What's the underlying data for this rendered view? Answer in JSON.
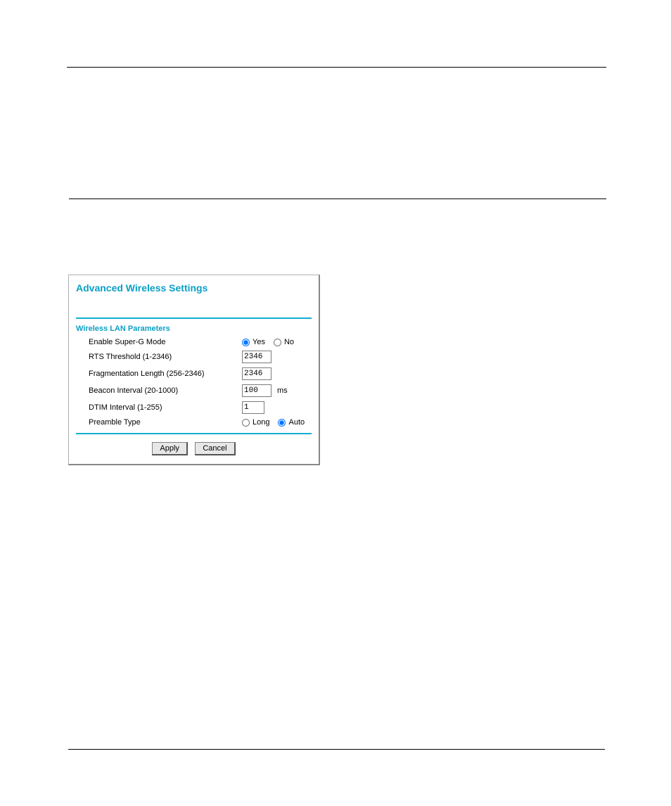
{
  "panel": {
    "title": "Advanced Wireless Settings",
    "section_title": "Wireless LAN Parameters",
    "rows": {
      "super_g": {
        "label": "Enable Super-G Mode",
        "yes": "Yes",
        "no": "No",
        "selected": "yes"
      },
      "rts": {
        "label": "RTS Threshold (1-2346)",
        "value": "2346"
      },
      "frag": {
        "label": "Fragmentation Length (256-2346)",
        "value": "2346"
      },
      "beacon": {
        "label": "Beacon Interval (20-1000)",
        "value": "100",
        "unit": "ms"
      },
      "dtim": {
        "label": "DTIM Interval (1-255)",
        "value": "1"
      },
      "preamble": {
        "label": "Preamble Type",
        "long": "Long",
        "auto": "Auto",
        "selected": "auto"
      }
    },
    "buttons": {
      "apply": "Apply",
      "cancel": "Cancel"
    }
  }
}
